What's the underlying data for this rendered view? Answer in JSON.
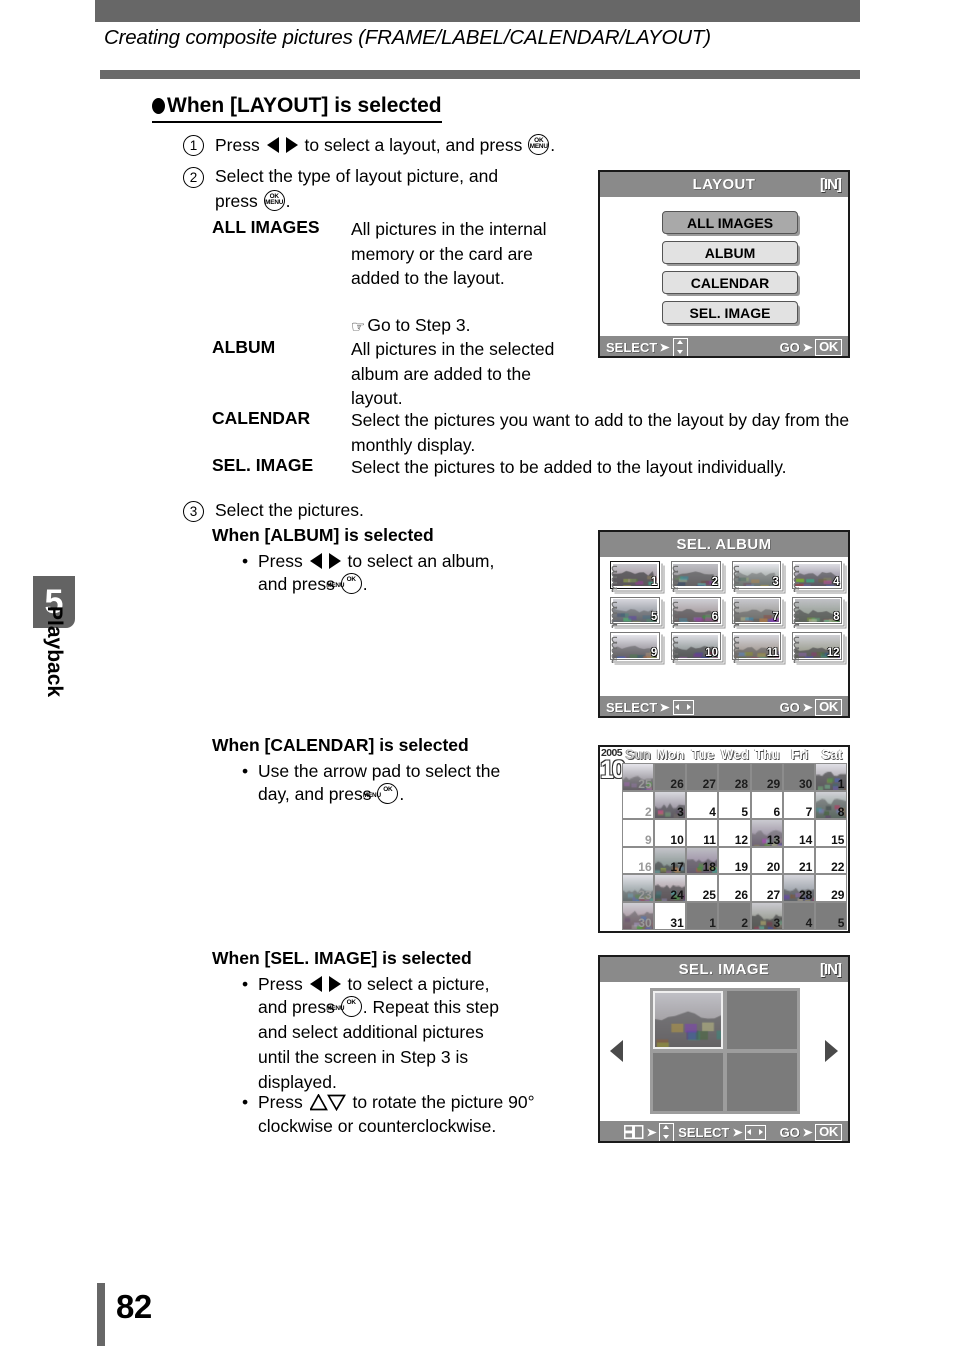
{
  "header": {
    "title": "Creating composite pictures (FRAME/LABEL/CALENDAR/LAYOUT)"
  },
  "section": {
    "heading": "When [LAYOUT] is selected"
  },
  "sidebar": {
    "chapter_number": "5",
    "chapter_label": "Playback"
  },
  "footer": {
    "page_number": "82"
  },
  "steps": {
    "step1": {
      "number": "1",
      "text_before": "Press",
      "text_mid": "to select a layout, and press",
      "text_after": "."
    },
    "step2": {
      "number": "2",
      "line1": "Select the type of layout picture, and",
      "line2_before": "press",
      "line2_after": ".",
      "options": [
        {
          "term": "ALL IMAGES",
          "desc": "All pictures in the internal memory or the card are added to the layout.",
          "note": "Go to Step 3."
        },
        {
          "term": "ALBUM",
          "desc": "All pictures in the selected album are added to the layout."
        },
        {
          "term": "CALENDAR",
          "desc": "Select the pictures you want to add to the layout by day from the monthly display."
        },
        {
          "term": "SEL. IMAGE",
          "desc": "Select the pictures to be added to the layout individually."
        }
      ]
    },
    "step3": {
      "number": "3",
      "text": "Select the pictures.",
      "album": {
        "heading": "When [ALBUM] is selected",
        "bullet_before": "Press",
        "bullet_mid": "to select an album,",
        "bullet_line2_before": "and press",
        "bullet_line2_after": "."
      },
      "calendar": {
        "heading": "When [CALENDAR] is selected",
        "bullet_line1": "Use the arrow pad to select the",
        "bullet_line2_before": "day, and press",
        "bullet_line2_after": "."
      },
      "sel_image": {
        "heading": "When [SEL. IMAGE] is selected",
        "bullet1_before": "Press",
        "bullet1_mid": "to select a picture,",
        "bullet1_line2_before": "and press",
        "bullet1_line2_after": ". Repeat this step",
        "bullet1_line3": "and select additional pictures",
        "bullet1_line4": "until the screen in Step 3 is",
        "bullet1_line5": "displayed.",
        "bullet2_before": "Press",
        "bullet2_mid": "to rotate the picture 90°",
        "bullet2_line2": "clockwise or counterclockwise."
      }
    }
  },
  "screens": {
    "layout_menu": {
      "title": "LAYOUT",
      "media_badge": "[IN]",
      "items": [
        {
          "label": "ALL IMAGES",
          "selected": true
        },
        {
          "label": "ALBUM",
          "selected": false
        },
        {
          "label": "CALENDAR",
          "selected": false
        },
        {
          "label": "SEL. IMAGE",
          "selected": false
        }
      ],
      "footer": {
        "select_label": "SELECT",
        "go_label": "GO",
        "ok_label": "OK"
      }
    },
    "sel_album": {
      "title": "SEL. ALBUM",
      "albums": [
        {
          "number": "1",
          "selected": true
        },
        {
          "number": "2",
          "selected": false
        },
        {
          "number": "3",
          "selected": false
        },
        {
          "number": "4",
          "selected": false
        },
        {
          "number": "5",
          "selected": false
        },
        {
          "number": "6",
          "selected": false
        },
        {
          "number": "7",
          "selected": false
        },
        {
          "number": "8",
          "selected": false
        },
        {
          "number": "9",
          "selected": false
        },
        {
          "number": "10",
          "selected": false
        },
        {
          "number": "11",
          "selected": false
        },
        {
          "number": "12",
          "selected": false
        }
      ],
      "footer": {
        "select_label": "SELECT",
        "go_label": "GO",
        "ok_label": "OK"
      }
    },
    "calendar": {
      "year": "2005",
      "month": "10",
      "weekdays": [
        "Sun",
        "Mon",
        "Tue",
        "Wed",
        "Thu",
        "Fri",
        "Sat"
      ],
      "weeks": [
        [
          {
            "day": "25",
            "other": true,
            "photo": true
          },
          {
            "day": "26",
            "other": true,
            "photo": false
          },
          {
            "day": "27",
            "other": true,
            "photo": false
          },
          {
            "day": "28",
            "other": true,
            "photo": false
          },
          {
            "day": "29",
            "other": true,
            "photo": false
          },
          {
            "day": "30",
            "other": true,
            "photo": false
          },
          {
            "day": "1",
            "other": false,
            "photo": true
          }
        ],
        [
          {
            "day": "2",
            "other": false,
            "photo": false
          },
          {
            "day": "3",
            "other": false,
            "photo": true
          },
          {
            "day": "4",
            "other": false,
            "photo": false
          },
          {
            "day": "5",
            "other": false,
            "photo": false
          },
          {
            "day": "6",
            "other": false,
            "photo": false
          },
          {
            "day": "7",
            "other": false,
            "photo": false
          },
          {
            "day": "8",
            "other": false,
            "photo": true
          }
        ],
        [
          {
            "day": "9",
            "other": false,
            "photo": false
          },
          {
            "day": "10",
            "other": false,
            "photo": false
          },
          {
            "day": "11",
            "other": false,
            "photo": false
          },
          {
            "day": "12",
            "other": false,
            "photo": false
          },
          {
            "day": "13",
            "other": false,
            "photo": true
          },
          {
            "day": "14",
            "other": false,
            "photo": false
          },
          {
            "day": "15",
            "other": false,
            "photo": false
          }
        ],
        [
          {
            "day": "16",
            "other": false,
            "photo": false
          },
          {
            "day": "17",
            "other": false,
            "photo": true
          },
          {
            "day": "18",
            "other": false,
            "photo": true
          },
          {
            "day": "19",
            "other": false,
            "photo": false
          },
          {
            "day": "20",
            "other": false,
            "photo": false
          },
          {
            "day": "21",
            "other": false,
            "photo": false
          },
          {
            "day": "22",
            "other": false,
            "photo": false
          }
        ],
        [
          {
            "day": "23",
            "other": false,
            "photo": true
          },
          {
            "day": "24",
            "other": false,
            "photo": true
          },
          {
            "day": "25",
            "other": false,
            "photo": false
          },
          {
            "day": "26",
            "other": false,
            "photo": false
          },
          {
            "day": "27",
            "other": false,
            "photo": false
          },
          {
            "day": "28",
            "other": false,
            "photo": true
          },
          {
            "day": "29",
            "other": false,
            "photo": false
          }
        ],
        [
          {
            "day": "30",
            "other": false,
            "photo": true
          },
          {
            "day": "31",
            "other": false,
            "photo": false
          },
          {
            "day": "1",
            "other": true,
            "photo": false
          },
          {
            "day": "2",
            "other": true,
            "photo": false
          },
          {
            "day": "3",
            "other": true,
            "photo": true
          },
          {
            "day": "4",
            "other": true,
            "photo": false
          },
          {
            "day": "5",
            "other": true,
            "photo": false
          }
        ]
      ]
    },
    "sel_image": {
      "title": "SEL. IMAGE",
      "media_badge": "[IN]",
      "panes": [
        {
          "filled": true
        },
        {
          "filled": false
        },
        {
          "filled": false
        },
        {
          "filled": false
        }
      ],
      "footer": {
        "select_label": "SELECT",
        "go_label": "GO",
        "ok_label": "OK"
      }
    }
  }
}
